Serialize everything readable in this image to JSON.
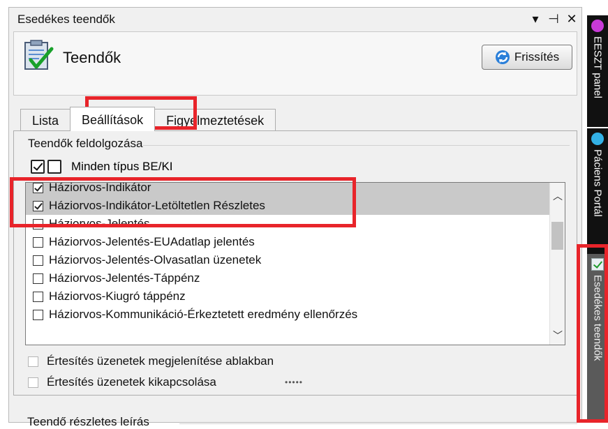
{
  "window": {
    "title": "Esedékes teendők",
    "controls": [
      "▾",
      "⊣",
      "✕"
    ]
  },
  "header": {
    "title": "Teendők",
    "refresh_label": "Frissítés"
  },
  "tabs": [
    {
      "label": "Lista"
    },
    {
      "label": "Beállítások"
    },
    {
      "label": "Figyelmeztetések"
    }
  ],
  "processing": {
    "group_label": "Teendők feldolgozása",
    "all_toggle_label": "Minden típus BE/KI"
  },
  "list": {
    "items": [
      {
        "label": "Háziorvos-Indikátor",
        "checked": true,
        "selected": true
      },
      {
        "label": "Háziorvos-Indikátor-Letöltetlen Részletes",
        "checked": true,
        "selected": true
      },
      {
        "label": "Háziorvos-Jelentés",
        "checked": false,
        "selected": false
      },
      {
        "label": "Háziorvos-Jelentés-EUAdatlap jelentés",
        "checked": false,
        "selected": false
      },
      {
        "label": "Háziorvos-Jelentés-Olvasatlan üzenetek",
        "checked": false,
        "selected": false
      },
      {
        "label": "Háziorvos-Jelentés-Táppénz",
        "checked": false,
        "selected": false
      },
      {
        "label": "Háziorvos-Kiugró táppénz",
        "checked": false,
        "selected": false
      },
      {
        "label": "Háziorvos-Kommunikáció-Érkeztetett eredmény ellenőrzés",
        "checked": false,
        "selected": false
      }
    ]
  },
  "options": {
    "show_in_window": "Értesítés üzenetek megjelenítése ablakban",
    "disable_notifications": "Értesítés üzenetek kikapcsolása"
  },
  "splitter": "•••••",
  "details": {
    "group_label": "Teendő részletes leírás"
  },
  "sidebar": {
    "tabs": [
      {
        "label": "EESZT panel",
        "icon": "purple-dot-icon",
        "color": "#c93ad8"
      },
      {
        "label": "Páciens Portál",
        "icon": "pp-icon",
        "color": "#33b1e6"
      },
      {
        "label": "Esedékes teendők",
        "icon": "clipboard-icon"
      }
    ]
  },
  "colors": {
    "highlight": "#e8242a",
    "selection": "#c9c9c9",
    "panel": "#f0f0f0"
  }
}
